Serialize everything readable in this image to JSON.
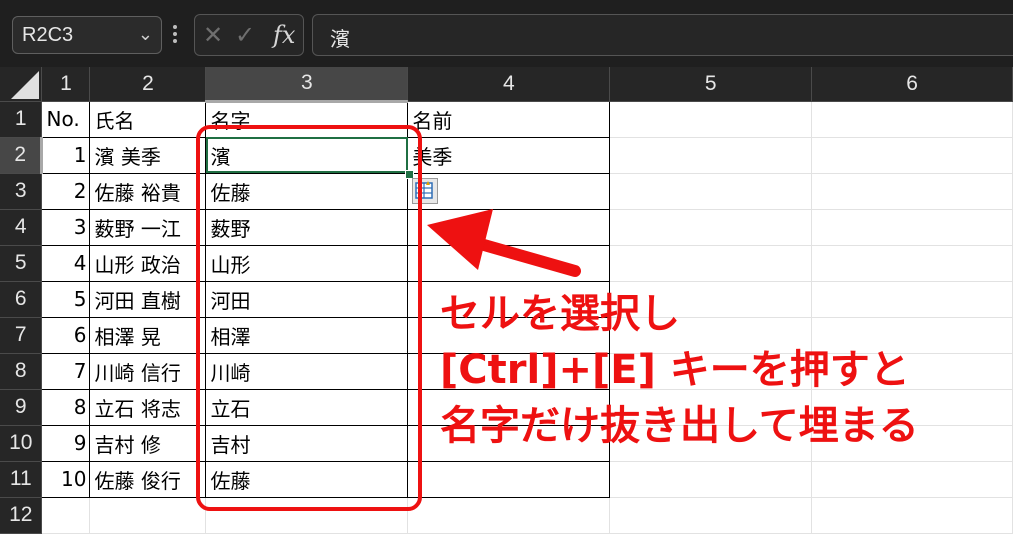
{
  "toolbar": {
    "name_box": "R2C3",
    "cancel_icon": "cross-icon",
    "enter_icon": "check-icon",
    "fx_label": "fx",
    "formula_value": "濱"
  },
  "grid": {
    "columns": [
      "1",
      "2",
      "3",
      "4",
      "5",
      "6"
    ],
    "rows": [
      {
        "n": "1",
        "c1": "No.",
        "c2": "氏名",
        "c3": "名字",
        "c4": "名前"
      },
      {
        "n": "2",
        "c1": "1",
        "c2": "濱 美季",
        "c3": "濱",
        "c4": "美季"
      },
      {
        "n": "3",
        "c1": "2",
        "c2": "佐藤 裕貴",
        "c3": "佐藤",
        "c4": ""
      },
      {
        "n": "4",
        "c1": "3",
        "c2": "薮野 一江",
        "c3": "薮野",
        "c4": ""
      },
      {
        "n": "5",
        "c1": "4",
        "c2": "山形 政治",
        "c3": "山形",
        "c4": ""
      },
      {
        "n": "6",
        "c1": "5",
        "c2": "河田 直樹",
        "c3": "河田",
        "c4": ""
      },
      {
        "n": "7",
        "c1": "6",
        "c2": "相澤 晃",
        "c3": "相澤",
        "c4": ""
      },
      {
        "n": "8",
        "c1": "7",
        "c2": "川崎 信行",
        "c3": "川崎",
        "c4": ""
      },
      {
        "n": "9",
        "c1": "8",
        "c2": "立石 将志",
        "c3": "立石",
        "c4": ""
      },
      {
        "n": "10",
        "c1": "9",
        "c2": "吉村 修",
        "c3": "吉村",
        "c4": ""
      },
      {
        "n": "11",
        "c1": "10",
        "c2": "佐藤 俊行",
        "c3": "佐藤",
        "c4": ""
      },
      {
        "n": "12",
        "c1": "",
        "c2": "",
        "c3": "",
        "c4": ""
      }
    ]
  },
  "annotation": {
    "line1": "セルを選択し",
    "line2": "[Ctrl]+[E] キーを押すと",
    "line3": "名字だけ抜き出して埋まる",
    "color": "#ee1111"
  }
}
